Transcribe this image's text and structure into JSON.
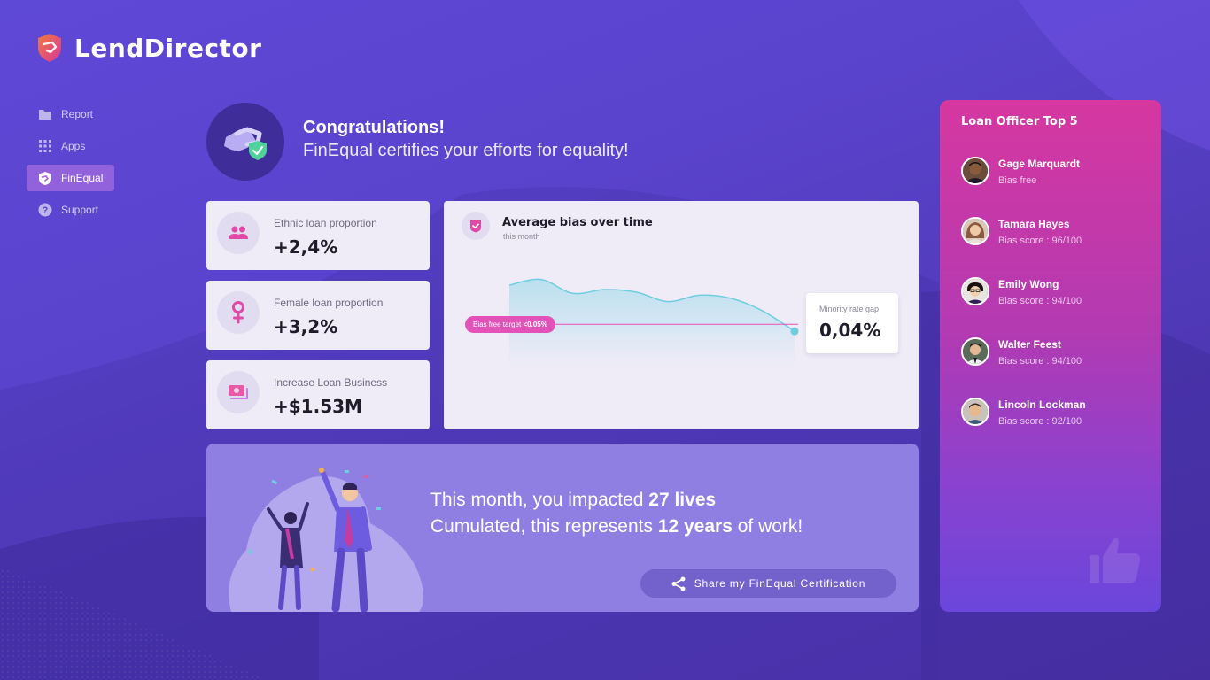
{
  "app": {
    "name": "LendDirector"
  },
  "sidebar": {
    "items": [
      {
        "label": "Report",
        "icon": "folder-icon",
        "active": false
      },
      {
        "label": "Apps",
        "icon": "grid-icon",
        "active": false
      },
      {
        "label": "FinEqual",
        "icon": "finequal-shield-icon",
        "active": true
      },
      {
        "label": "Support",
        "icon": "help-icon",
        "active": false
      }
    ]
  },
  "header": {
    "title": "Congratulations!",
    "subtitle": "FinEqual certifies your efforts for equality!"
  },
  "stats": [
    {
      "label": "Ethnic loan proportion",
      "value": "+2,4%",
      "icon": "people-icon"
    },
    {
      "label": "Female loan proportion",
      "value": "+3,2%",
      "icon": "female-icon"
    },
    {
      "label": "Increase Loan Business",
      "value": "+$1.53M",
      "icon": "money-icon"
    }
  ],
  "chart": {
    "title": "Average bias over time",
    "subtitle": "this month",
    "target_label": "Bias free target",
    "target_value": "<0.05%",
    "gap_label": "Minority rate gap",
    "gap_value": "0,04%"
  },
  "chart_data": {
    "type": "area",
    "title": "Average bias over time",
    "subtitle": "this month",
    "values": [
      0.112,
      0.121,
      0.099,
      0.105,
      0.101,
      0.086,
      0.096,
      0.091,
      0.071,
      0.039
    ],
    "target": 0.05,
    "ylim": [
      0,
      0.14
    ],
    "grid": false,
    "color": "#6fcde0"
  },
  "impact": {
    "line1_prefix": "This month, you impacted ",
    "line1_bold": "27 lives",
    "line2_prefix": "Cumulated, this represents ",
    "line2_bold": "12 years",
    "line2_suffix": " of work!",
    "share_label": "Share my FinEqual Certification"
  },
  "top_officers": {
    "title": "Loan Officer Top 5",
    "items": [
      {
        "name": "Gage Marquardt",
        "score": "Bias free"
      },
      {
        "name": "Tamara Hayes",
        "score": "Bias score : 96/100"
      },
      {
        "name": "Emily Wong",
        "score": "Bias score : 94/100"
      },
      {
        "name": "Walter Feest",
        "score": "Bias score : 94/100"
      },
      {
        "name": "Lincoln Lockman",
        "score": "Bias score : 92/100"
      }
    ]
  },
  "colors": {
    "accent_pink": "#e352b9",
    "chart_teal": "#6fcde0",
    "background": "#5a43cc"
  }
}
